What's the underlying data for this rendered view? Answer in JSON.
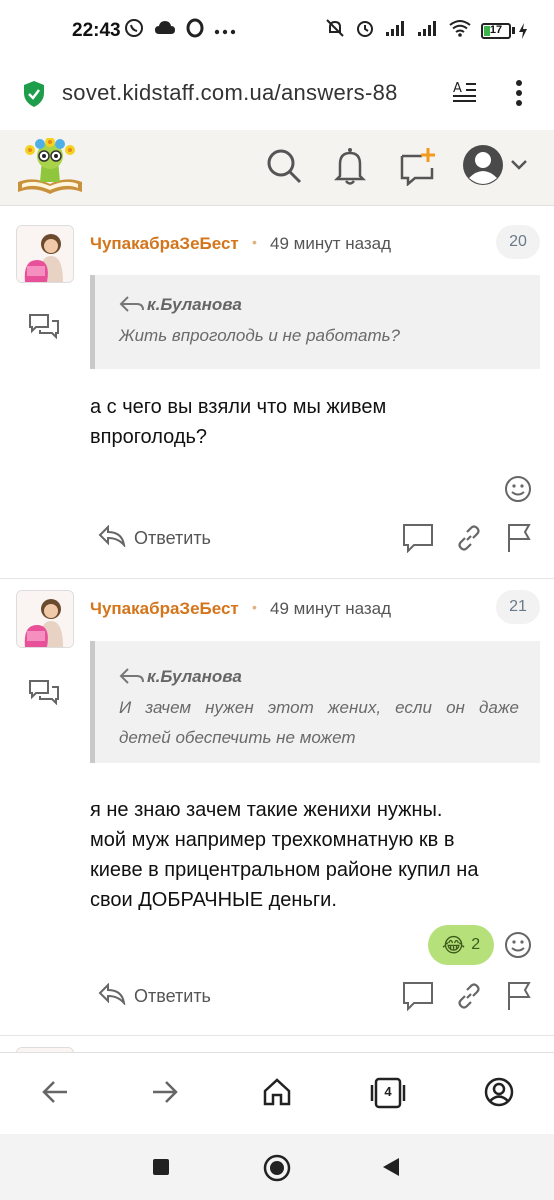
{
  "status_bar": {
    "time": "22:43",
    "left_icons": [
      "viber-icon",
      "cloud-icon",
      "opera-icon",
      "more-dots-icon"
    ],
    "right_icons": [
      "mute-icon",
      "alarm-icon",
      "signal-icon",
      "signal-icon",
      "wifi-icon"
    ],
    "battery": "17",
    "colors": {
      "battery_fill": "#3bb54a"
    }
  },
  "url_bar": {
    "url": "sovet.kidstaff.com.ua/answers-88",
    "icons": [
      "secure-shield-icon",
      "reader-mode-icon",
      "menu-dots-icon"
    ],
    "colors": {
      "shield": "#1e9e4a"
    }
  },
  "site_header": {
    "icons": [
      "site-logo",
      "search-icon",
      "bell-icon",
      "new-message-icon",
      "profile-avatar-icon",
      "chevron-down-icon"
    ],
    "colors": {
      "background": "#f5f3ef",
      "accent": "#f29a1d"
    }
  },
  "posts": [
    {
      "author": "ЧупакабраЗеБест",
      "time": "49 минут назад",
      "number": "20",
      "quote_author": "к.Буланова",
      "quote_lines": [
        "Жить впроголодь и не работать?"
      ],
      "text_lines": [
        "а с чего вы взяли что мы живем",
        "впроголодь?"
      ],
      "reply_label": "Ответить"
    },
    {
      "author": "ЧупакабраЗеБест",
      "time": "49 минут назад",
      "number": "21",
      "quote_author": "к.Буланова",
      "quote_lines": [
        "И зачем нужен этот жених, если он даже",
        "детей обеспечить не может"
      ],
      "text_lines": [
        "я не знаю зачем такие женихи нужны.",
        "мой муж например трехкомнатную кв в",
        "киеве в прицентральном районе купил на",
        "свои ДОБРАЧНЫЕ деньги."
      ],
      "reaction_emoji": "😂",
      "reaction_count": "2",
      "reply_label": "Ответить"
    }
  ],
  "browser_nav": {
    "tab_count": "4",
    "icons": [
      "back-arrow-icon",
      "forward-arrow-icon",
      "home-icon",
      "tabs-icon",
      "account-icon"
    ]
  },
  "android_nav": {
    "icons": [
      "recents-square-icon",
      "home-circle-icon",
      "back-triangle-icon"
    ]
  },
  "colors": {
    "author": "#d4751c",
    "quote_bg": "#f1f1f1",
    "reaction_bg": "#b5e07a"
  }
}
